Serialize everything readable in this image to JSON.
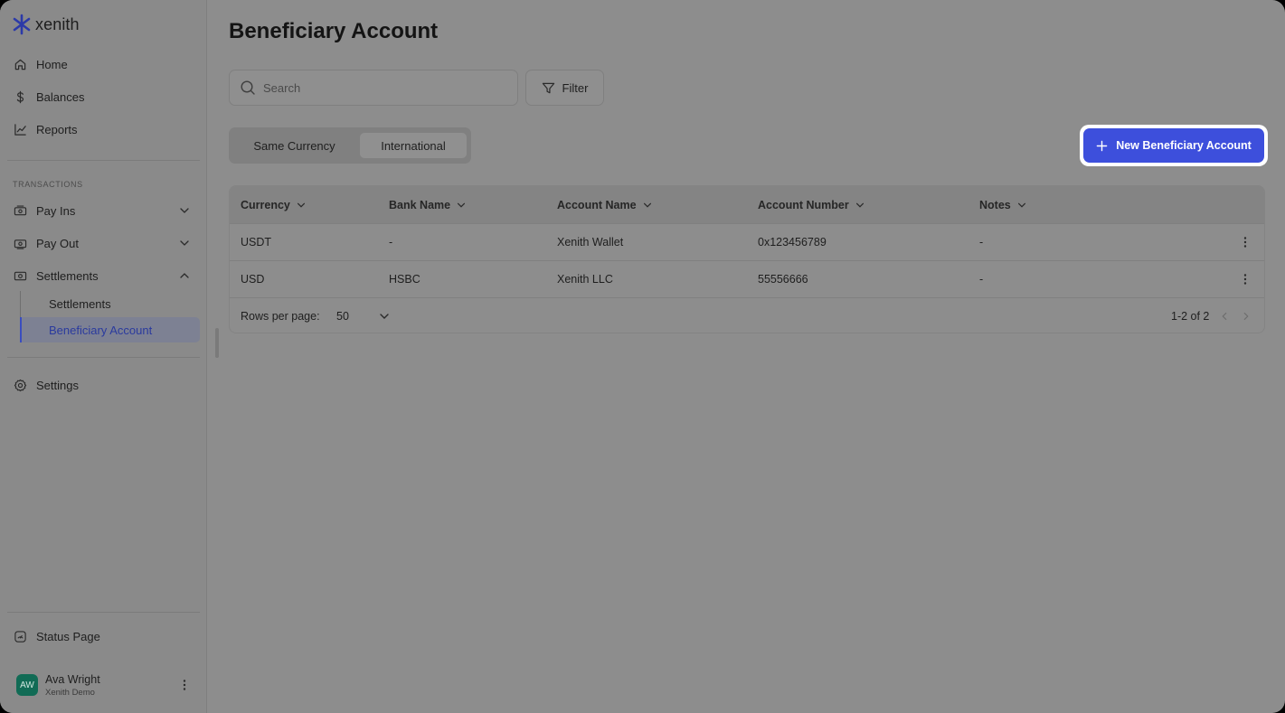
{
  "app": {
    "name": "xenith"
  },
  "sidebar": {
    "main": [
      {
        "label": "Home",
        "icon": "home-icon"
      },
      {
        "label": "Balances",
        "icon": "dollar-icon"
      },
      {
        "label": "Reports",
        "icon": "chart-icon"
      }
    ],
    "section_label": "TRANSACTIONS",
    "transactions": [
      {
        "label": "Pay Ins",
        "icon": "pay-in-icon",
        "expanded": false
      },
      {
        "label": "Pay Out",
        "icon": "pay-out-icon",
        "expanded": false
      },
      {
        "label": "Settlements",
        "icon": "settlements-icon",
        "expanded": true
      }
    ],
    "settlements_sub": [
      {
        "label": "Settlements",
        "active": false
      },
      {
        "label": "Beneficiary Account",
        "active": true
      }
    ],
    "settings": {
      "label": "Settings",
      "icon": "gear-icon"
    },
    "status_page": {
      "label": "Status Page",
      "icon": "status-icon"
    },
    "user": {
      "initials": "AW",
      "name": "Ava Wright",
      "org": "Xenith Demo"
    }
  },
  "main": {
    "title": "Beneficiary Account",
    "search": {
      "placeholder": "Search",
      "value": ""
    },
    "filter_label": "Filter",
    "tabs": [
      {
        "label": "Same Currency",
        "active": false
      },
      {
        "label": "International",
        "active": true
      }
    ],
    "new_button_label": "New Beneficiary Account"
  },
  "table": {
    "columns": [
      "Currency",
      "Bank Name",
      "Account Name",
      "Account Number",
      "Notes"
    ],
    "rows": [
      {
        "currency": "USDT",
        "bank_name": "-",
        "account_name": "Xenith Wallet",
        "account_number": "0x123456789",
        "notes": "-"
      },
      {
        "currency": "USD",
        "bank_name": "HSBC",
        "account_name": "Xenith LLC",
        "account_number": "55556666",
        "notes": "-"
      }
    ],
    "footer": {
      "rows_per_page_label": "Rows per page:",
      "rows_per_page": "50",
      "range": "1-2 of 2"
    }
  },
  "colors": {
    "accent": "#3d4fdc",
    "overlay": "#8d8d8d",
    "active_nav": "#2a3a9e"
  }
}
